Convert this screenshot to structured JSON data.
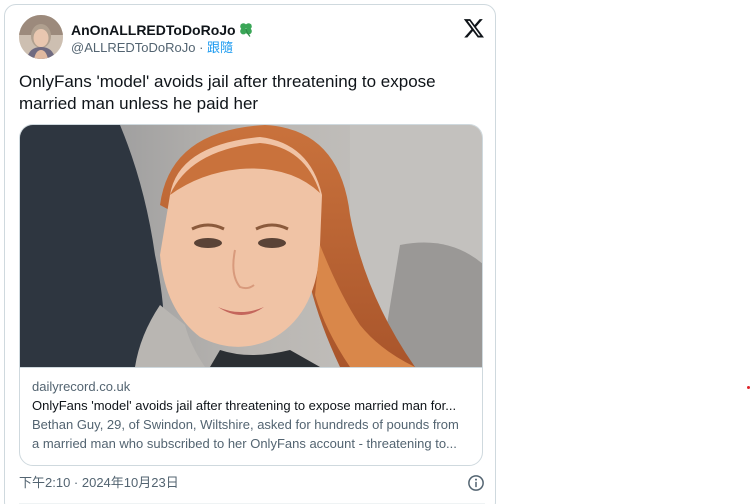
{
  "tweet": {
    "author": {
      "display_name": "AnOnALLREDToDoRoJo",
      "handle": "@ALLREDToDoRoJo",
      "separator": " · ",
      "follow_label": "跟隨"
    },
    "text": "OnlyFans 'model' avoids jail after threatening to expose married man unless he paid her",
    "link_card": {
      "domain": "dailyrecord.co.uk",
      "title": "OnlyFans 'model' avoids jail after threatening to expose married man for...",
      "description_line1": "Bethan Guy, 29, of Swindon, Wiltshire, asked for hundreds of pounds from",
      "description_line2": "a married man who subscribed to her OnlyFans account - threatening to..."
    },
    "timestamp": "下午2:10 · 2024年10月23日"
  },
  "icons": {
    "logo": "x-logo-icon",
    "emoji": "four-leaf-clover-icon",
    "info": "info-icon"
  },
  "colors": {
    "link_blue": "#1d9bf0",
    "secondary_text": "#536471",
    "primary_text": "#0f1419",
    "border": "#cfd9de",
    "clover_green": "#3aa657"
  }
}
